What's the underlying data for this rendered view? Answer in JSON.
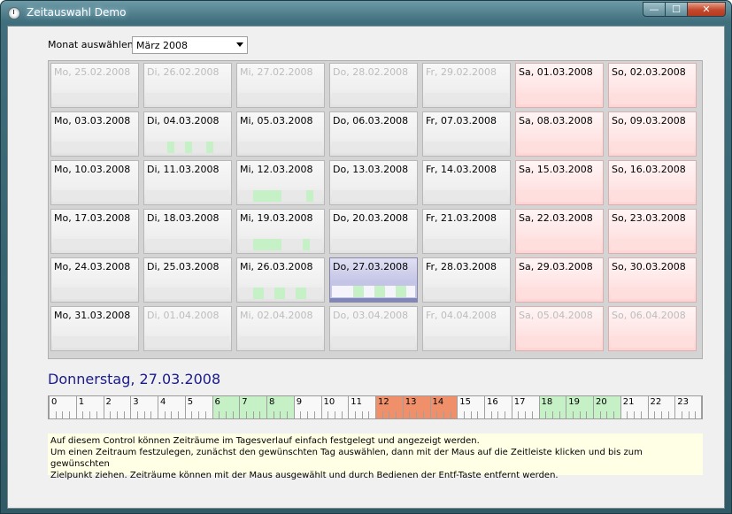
{
  "window": {
    "title": "Zeitauswahl Demo",
    "min_glyph": "—",
    "max_glyph": "☐",
    "close_glyph": "✕"
  },
  "month": {
    "label": "Monat auswählen",
    "selected": "März 2008"
  },
  "calendar": {
    "weeks": [
      [
        {
          "text": "Mo, 25.02.2008",
          "out": true
        },
        {
          "text": "Di, 26.02.2008",
          "out": true
        },
        {
          "text": "Mi, 27.02.2008",
          "out": true
        },
        {
          "text": "Do, 28.02.2008",
          "out": true
        },
        {
          "text": "Fr, 29.02.2008",
          "out": true
        },
        {
          "text": "Sa, 01.03.2008",
          "out": false,
          "we": true
        },
        {
          "text": "So, 02.03.2008",
          "out": false,
          "we": true
        }
      ],
      [
        {
          "text": "Mo, 03.03.2008"
        },
        {
          "text": "Di, 04.03.2008",
          "segs": [
            [
              6,
              8
            ],
            [
              11,
              13
            ],
            [
              17,
              19
            ]
          ]
        },
        {
          "text": "Mi, 05.03.2008"
        },
        {
          "text": "Do, 06.03.2008"
        },
        {
          "text": "Fr, 07.03.2008"
        },
        {
          "text": "Sa, 08.03.2008",
          "we": true
        },
        {
          "text": "So, 09.03.2008",
          "we": true
        }
      ],
      [
        {
          "text": "Mo, 10.03.2008"
        },
        {
          "text": "Di, 11.03.2008"
        },
        {
          "text": "Mi, 12.03.2008",
          "segs": [
            [
              4,
              12
            ],
            [
              19,
              21
            ]
          ]
        },
        {
          "text": "Do, 13.03.2008"
        },
        {
          "text": "Fr, 14.03.2008"
        },
        {
          "text": "Sa, 15.03.2008",
          "we": true
        },
        {
          "text": "So, 16.03.2008",
          "we": true
        }
      ],
      [
        {
          "text": "Mo, 17.03.2008"
        },
        {
          "text": "Di, 18.03.2008"
        },
        {
          "text": "Mi, 19.03.2008",
          "segs": [
            [
              4,
              12
            ],
            [
              18,
              20
            ]
          ]
        },
        {
          "text": "Do, 20.03.2008"
        },
        {
          "text": "Fr, 21.03.2008"
        },
        {
          "text": "Sa, 22.03.2008",
          "we": true
        },
        {
          "text": "So, 23.03.2008",
          "we": true
        }
      ],
      [
        {
          "text": "Mo, 24.03.2008"
        },
        {
          "text": "Di, 25.03.2008"
        },
        {
          "text": "Mi, 26.03.2008",
          "segs": [
            [
              4,
              7
            ],
            [
              10,
              13
            ],
            [
              16,
              19
            ]
          ]
        },
        {
          "text": "Do, 27.03.2008",
          "sel": true,
          "segs": [
            [
              6,
              9
            ],
            [
              12,
              15
            ],
            [
              18,
              21
            ]
          ]
        },
        {
          "text": "Fr, 28.03.2008"
        },
        {
          "text": "Sa, 29.03.2008",
          "we": true
        },
        {
          "text": "So, 30.03.2008",
          "we": true
        }
      ],
      [
        {
          "text": "Mo, 31.03.2008"
        },
        {
          "text": "Di, 01.04.2008",
          "out": true
        },
        {
          "text": "Mi, 02.04.2008",
          "out": true
        },
        {
          "text": "Do, 03.04.2008",
          "out": true
        },
        {
          "text": "Fr, 04.04.2008",
          "out": true
        },
        {
          "text": "Sa, 05.04.2008",
          "out": true,
          "we": true
        },
        {
          "text": "So, 06.04.2008",
          "out": true,
          "we": true
        }
      ]
    ]
  },
  "selected_day": "Donnerstag, 27.03.2008",
  "timeline": {
    "hours": [
      "0",
      "1",
      "2",
      "3",
      "4",
      "5",
      "6",
      "7",
      "8",
      "9",
      "10",
      "11",
      "12",
      "13",
      "14",
      "15",
      "16",
      "17",
      "18",
      "19",
      "20",
      "21",
      "22",
      "23"
    ],
    "green_ranges": [
      [
        6,
        9
      ],
      [
        18,
        21
      ]
    ],
    "selected_range": [
      12,
      15
    ],
    "colors": {
      "green": "#c6f0c6",
      "selected": "#f0906a"
    }
  },
  "info": {
    "lines": [
      "Auf diesem Control können Zeiträume im Tagesverlauf einfach festgelegt und angezeigt werden.",
      "Um einen Zeitraum festzulegen, zunächst den gewünschten Tag auswählen, dann mit der Maus auf die Zeitleiste klicken und bis zum gewünschten",
      "Zielpunkt ziehen. Zeiträume können mit der Maus ausgewählt und durch Bedienen der Entf-Taste entfernt werden."
    ]
  }
}
